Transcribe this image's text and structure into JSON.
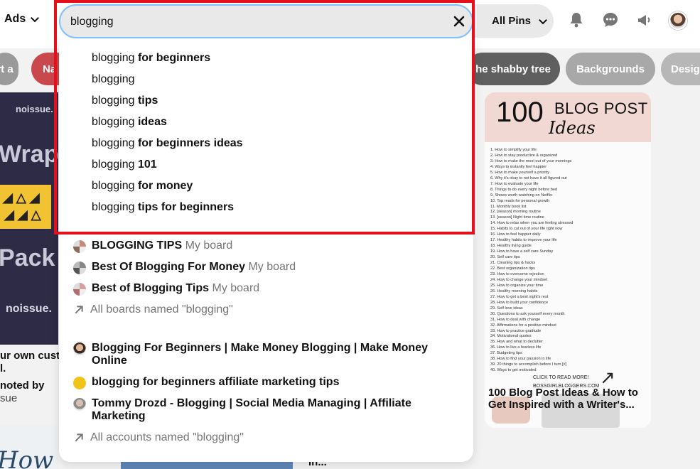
{
  "header": {
    "ads_label": "Ads",
    "allpins_label": "All Pins",
    "icons": [
      "chevron-down-icon",
      "bell-icon",
      "chat-icon",
      "megaphone-icon"
    ]
  },
  "search": {
    "value": "blogging",
    "clear_icon": "close-icon"
  },
  "suggestions": [
    {
      "prefix": "blogging",
      "bold": " for beginners"
    },
    {
      "prefix": "blogging",
      "bold": ""
    },
    {
      "prefix": "blogging",
      "bold": " tips"
    },
    {
      "prefix": "blogging",
      "bold": " ideas"
    },
    {
      "prefix": "blogging",
      "bold": " for beginners ideas"
    },
    {
      "prefix": "blogging",
      "bold": " 101"
    },
    {
      "prefix": "blogging",
      "bold": " for money"
    },
    {
      "prefix": "blogging",
      "bold": " tips for beginners"
    }
  ],
  "boards": [
    {
      "title": "BLOGGING TIPS",
      "meta": "My board"
    },
    {
      "title": "Best Of Blogging For Money",
      "meta": "My board"
    },
    {
      "title": "Best of Blogging Tips",
      "meta": "My board"
    }
  ],
  "boards_all_label": "All boards named \"blogging\"",
  "accounts": [
    {
      "title": "Blogging For Beginners | Make Money Blogging | Make Money Online"
    },
    {
      "title": "blogging for beginners affiliate marketing tips"
    },
    {
      "title": "Tommy Drozd - Blogging | Social Media Managing | Affiliate Marketing"
    }
  ],
  "accounts_all_label": "All accounts named \"blogging\"",
  "background": {
    "chips": [
      "rt a",
      "Na",
      "he shabby tree",
      "Backgrounds",
      "Desig"
    ],
    "left_pin": {
      "brand": "noissue.",
      "big1": "Wrap it",
      "big2": "Pack it",
      "brand2": "noissue."
    },
    "left_caption": {
      "line1": "ur own custo",
      "line2": "l.",
      "promoted": "noted by",
      "sub": "sue"
    },
    "right_pin": {
      "num": "100",
      "title": "BLOG POST",
      "script": "Ideas",
      "list": [
        "1. How to simplify your life",
        "2. How to stay productive & organized",
        "3. How to make the most out of your mornings",
        "4. Ways to instantly feel happier",
        "5. How to make yourself a priority",
        "6. Why it's okay to not have it all figured out",
        "7. How to evaluate your life",
        "8. Things to do every night before bed",
        "9. Shows worth watching on Netflix",
        "10. Top reads for personal growth",
        "11. Monthly book list",
        "12. [season] morning routine",
        "13. [season] Night time routine",
        "14. How to relax when you are feeling stressed",
        "15. Habits to cut out of your life right now",
        "16. How to feel happier daily",
        "17. Healthy habits to improve your life",
        "18. Healthy living guide",
        "19. How to have a self care Sunday",
        "20. Self care tips",
        "21. Cleaning tips & hacks",
        "22. Best organization tips",
        "23. How to overcome rejection",
        "24. How to change your mindset",
        "25. How to organize your time",
        "26. Healthy morning habits",
        "27. How to get a best night's rest",
        "28. How to build your confidence",
        "29. Self love ideas",
        "30. Questions to ask yourself every month",
        "31. How to deal with change",
        "32. Affirmations for a positive mindset",
        "33. How to practice gratitude",
        "34. Motivational quotes",
        "35. How and what to declutter",
        "36. How to live a fearless life",
        "37. Budgeting tips",
        "38. How to find your passion in life",
        "39. 20 things to accomplish before I turn [#]",
        "40. Ways to get motivated"
      ],
      "cta": "CLICK TO READ MORE!",
      "site": "BOSSGIRLBLOGGERS.COM",
      "caption": "100 Blog Post Ideas & How to Get Inspired with a Writer's..."
    },
    "bottom_left": "How To",
    "bottom_mid": "In..."
  }
}
